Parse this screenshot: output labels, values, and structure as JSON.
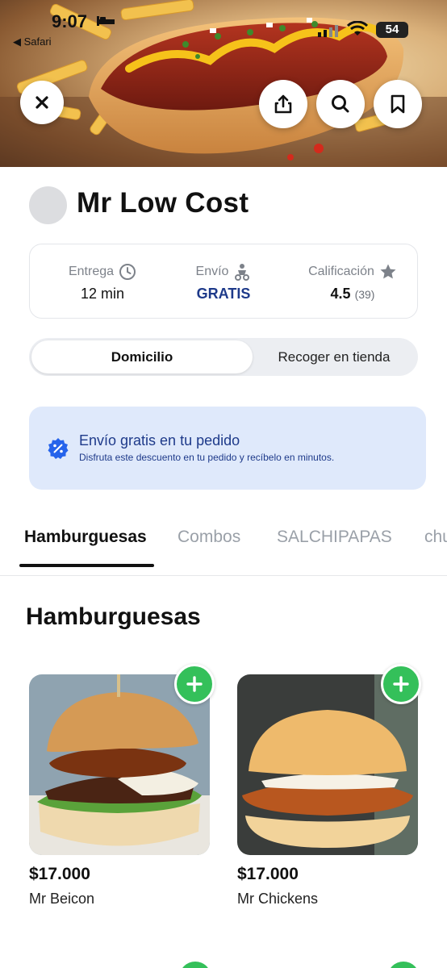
{
  "status_bar": {
    "time": "9:07",
    "back_app": "◀ Safari",
    "battery": "54"
  },
  "hero": {
    "close_icon": "close-icon",
    "share_icon": "share-icon",
    "search_icon": "search-icon",
    "bookmark_icon": "bookmark-icon"
  },
  "store": {
    "name": "Mr Low Cost"
  },
  "info": {
    "delivery_label": "Entrega",
    "delivery_value": "12 min",
    "shipping_label": "Envío",
    "shipping_value": "GRATIS",
    "rating_label": "Calificación",
    "rating_value": "4.5",
    "rating_count": "(39)"
  },
  "mode_toggle": {
    "options": [
      "Domicilio",
      "Recoger en tienda"
    ],
    "selected": "Domicilio"
  },
  "promo": {
    "title": "Envío gratis en tu pedido",
    "subtitle": "Disfruta este descuento en tu pedido y recíbelo en minutos."
  },
  "tabs": [
    "Hamburguesas",
    "Combos",
    "SALCHIPAPAS",
    "chu"
  ],
  "section": {
    "title": "Hamburguesas"
  },
  "products": [
    {
      "price": "$17.000",
      "name": "Mr Beicon"
    },
    {
      "price": "$17.000",
      "name": "Mr Chickens"
    }
  ],
  "colors": {
    "accent_blue": "#1e3a8a",
    "promo_bg": "#dfe9fb",
    "add_green": "#34c05a"
  }
}
